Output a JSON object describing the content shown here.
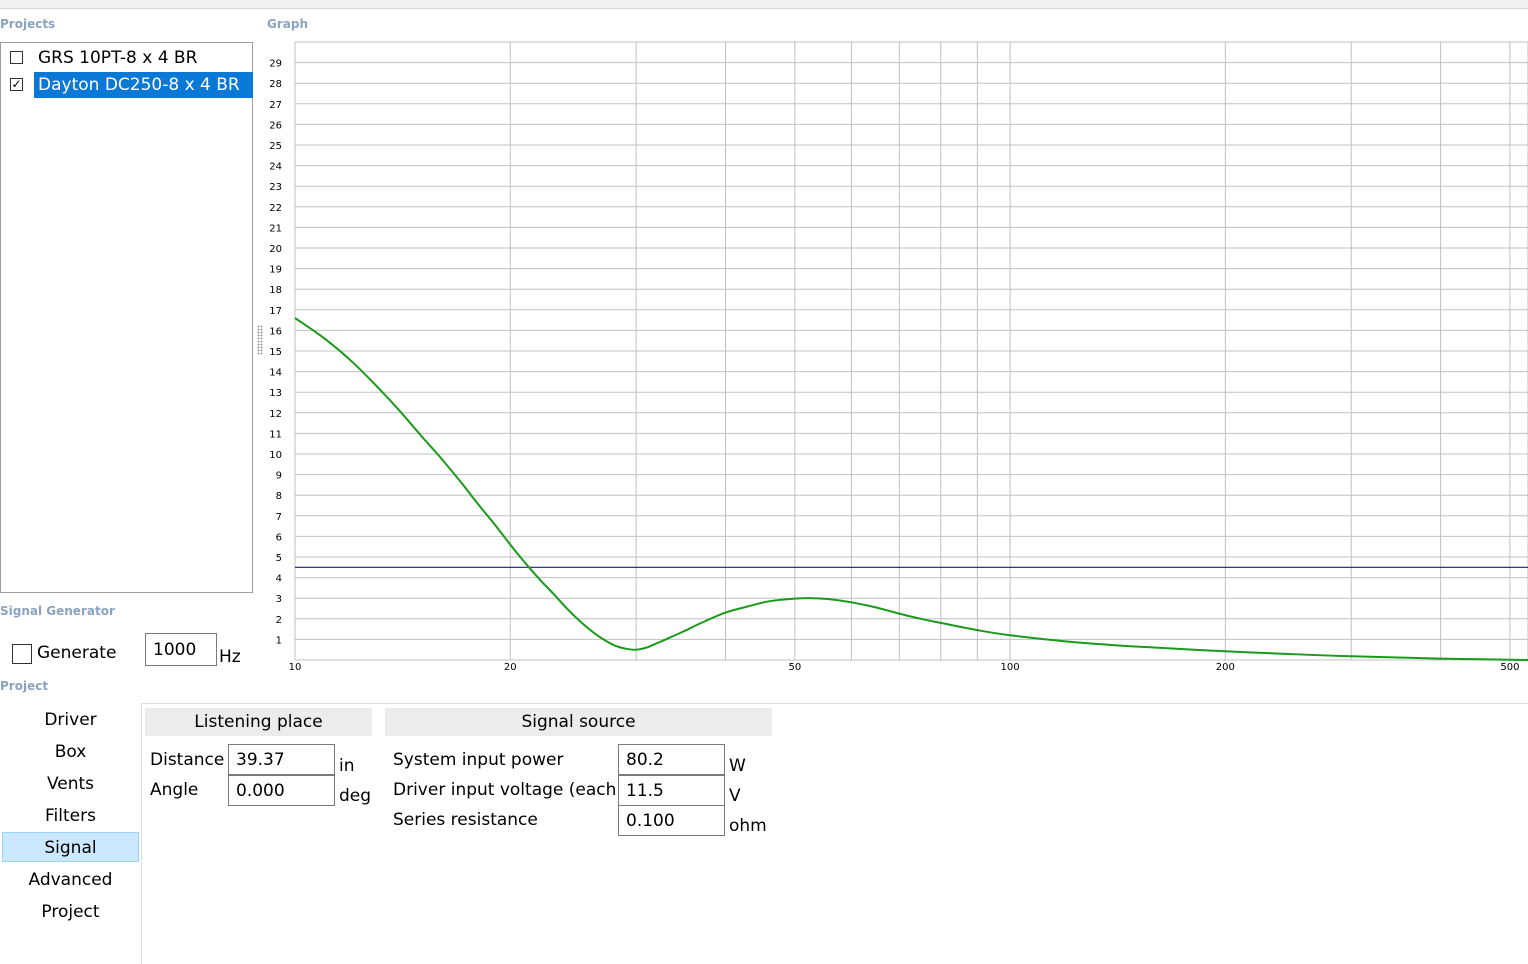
{
  "groups": {
    "projects": "Projects",
    "graph": "Graph",
    "signal_generator": "Signal Generator",
    "project": "Project"
  },
  "projects": [
    {
      "name": "GRS 10PT-8 x 4 BR",
      "checked": false,
      "selected": false
    },
    {
      "name": "Dayton DC250-8 x 4 BR",
      "checked": true,
      "selected": true
    }
  ],
  "signal_generator": {
    "generate_label": "Generate",
    "generate_checked": false,
    "frequency": "1000",
    "unit": "Hz"
  },
  "nav": [
    "Driver",
    "Box",
    "Vents",
    "Filters",
    "Signal",
    "Advanced",
    "Project"
  ],
  "nav_active": "Signal",
  "listening_place": {
    "title": "Listening place",
    "distance_label": "Distance",
    "distance_value": "39.37",
    "distance_unit": "in",
    "angle_label": "Angle",
    "angle_value": "0.000",
    "angle_unit": "deg"
  },
  "signal_source": {
    "title": "Signal source",
    "power_label": "System input power",
    "power_value": "80.2",
    "power_unit": "W",
    "voltage_label": "Driver input voltage (each)",
    "voltage_value": "11.5",
    "voltage_unit": "V",
    "resistance_label": "Series resistance",
    "resistance_value": "0.100",
    "resistance_unit": "ohm"
  },
  "chart_data": {
    "type": "line",
    "x_scale": "log",
    "xlim": [
      10,
      530
    ],
    "ylim": [
      0,
      30
    ],
    "x_ticks": [
      10,
      20,
      50,
      100,
      200,
      500
    ],
    "x_tick_labels": [
      "10",
      "20",
      "50",
      "100",
      "200",
      "500"
    ],
    "y_ticks": [
      1,
      2,
      3,
      4,
      5,
      6,
      7,
      8,
      9,
      10,
      11,
      12,
      13,
      14,
      15,
      16,
      17,
      18,
      19,
      20,
      21,
      22,
      23,
      24,
      25,
      26,
      27,
      28,
      29
    ],
    "grid": true,
    "colors": {
      "curve": "#1a9a1a",
      "reference": "#1c1c7a",
      "grid": "#c0c0c0"
    },
    "series": [
      {
        "x": [
          10,
          11,
          12,
          13,
          14,
          15,
          16,
          17,
          18,
          19,
          20,
          21,
          22,
          23,
          24,
          25,
          26,
          27,
          28,
          29,
          30,
          31,
          32,
          33,
          35,
          37,
          40,
          43,
          46,
          50,
          53,
          56,
          60,
          65,
          70,
          75,
          80,
          90,
          100,
          120,
          140,
          160,
          200,
          250,
          300,
          400,
          530
        ],
        "y": [
          16.6,
          15.6,
          14.5,
          13.3,
          12.1,
          10.9,
          9.8,
          8.7,
          7.6,
          6.6,
          5.6,
          4.7,
          3.9,
          3.2,
          2.5,
          1.9,
          1.4,
          1.0,
          0.7,
          0.55,
          0.5,
          0.6,
          0.8,
          1.0,
          1.4,
          1.8,
          2.3,
          2.6,
          2.85,
          2.98,
          3.0,
          2.95,
          2.8,
          2.55,
          2.25,
          2.0,
          1.8,
          1.45,
          1.2,
          0.9,
          0.72,
          0.6,
          0.42,
          0.28,
          0.18,
          0.07,
          0.0
        ]
      },
      {
        "x": [
          10,
          530
        ],
        "y": [
          4.5,
          4.5
        ]
      }
    ]
  }
}
